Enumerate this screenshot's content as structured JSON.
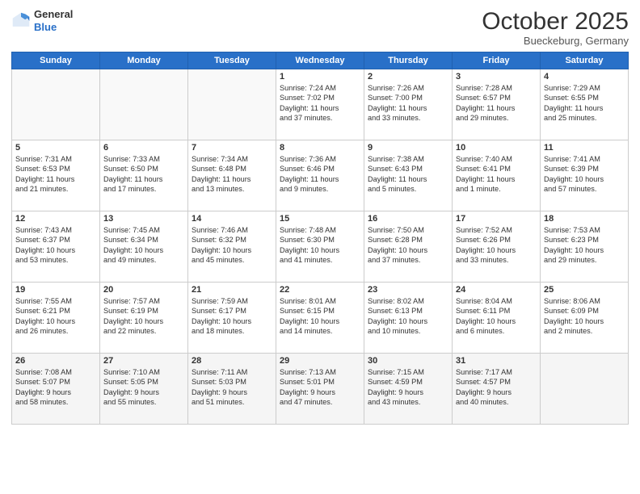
{
  "header": {
    "logo_general": "General",
    "logo_blue": "Blue",
    "month": "October 2025",
    "location": "Bueckeburg, Germany"
  },
  "days_of_week": [
    "Sunday",
    "Monday",
    "Tuesday",
    "Wednesday",
    "Thursday",
    "Friday",
    "Saturday"
  ],
  "weeks": [
    [
      {
        "day": "",
        "content": ""
      },
      {
        "day": "",
        "content": ""
      },
      {
        "day": "",
        "content": ""
      },
      {
        "day": "1",
        "content": "Sunrise: 7:24 AM\nSunset: 7:02 PM\nDaylight: 11 hours\nand 37 minutes."
      },
      {
        "day": "2",
        "content": "Sunrise: 7:26 AM\nSunset: 7:00 PM\nDaylight: 11 hours\nand 33 minutes."
      },
      {
        "day": "3",
        "content": "Sunrise: 7:28 AM\nSunset: 6:57 PM\nDaylight: 11 hours\nand 29 minutes."
      },
      {
        "day": "4",
        "content": "Sunrise: 7:29 AM\nSunset: 6:55 PM\nDaylight: 11 hours\nand 25 minutes."
      }
    ],
    [
      {
        "day": "5",
        "content": "Sunrise: 7:31 AM\nSunset: 6:53 PM\nDaylight: 11 hours\nand 21 minutes."
      },
      {
        "day": "6",
        "content": "Sunrise: 7:33 AM\nSunset: 6:50 PM\nDaylight: 11 hours\nand 17 minutes."
      },
      {
        "day": "7",
        "content": "Sunrise: 7:34 AM\nSunset: 6:48 PM\nDaylight: 11 hours\nand 13 minutes."
      },
      {
        "day": "8",
        "content": "Sunrise: 7:36 AM\nSunset: 6:46 PM\nDaylight: 11 hours\nand 9 minutes."
      },
      {
        "day": "9",
        "content": "Sunrise: 7:38 AM\nSunset: 6:43 PM\nDaylight: 11 hours\nand 5 minutes."
      },
      {
        "day": "10",
        "content": "Sunrise: 7:40 AM\nSunset: 6:41 PM\nDaylight: 11 hours\nand 1 minute."
      },
      {
        "day": "11",
        "content": "Sunrise: 7:41 AM\nSunset: 6:39 PM\nDaylight: 10 hours\nand 57 minutes."
      }
    ],
    [
      {
        "day": "12",
        "content": "Sunrise: 7:43 AM\nSunset: 6:37 PM\nDaylight: 10 hours\nand 53 minutes."
      },
      {
        "day": "13",
        "content": "Sunrise: 7:45 AM\nSunset: 6:34 PM\nDaylight: 10 hours\nand 49 minutes."
      },
      {
        "day": "14",
        "content": "Sunrise: 7:46 AM\nSunset: 6:32 PM\nDaylight: 10 hours\nand 45 minutes."
      },
      {
        "day": "15",
        "content": "Sunrise: 7:48 AM\nSunset: 6:30 PM\nDaylight: 10 hours\nand 41 minutes."
      },
      {
        "day": "16",
        "content": "Sunrise: 7:50 AM\nSunset: 6:28 PM\nDaylight: 10 hours\nand 37 minutes."
      },
      {
        "day": "17",
        "content": "Sunrise: 7:52 AM\nSunset: 6:26 PM\nDaylight: 10 hours\nand 33 minutes."
      },
      {
        "day": "18",
        "content": "Sunrise: 7:53 AM\nSunset: 6:23 PM\nDaylight: 10 hours\nand 29 minutes."
      }
    ],
    [
      {
        "day": "19",
        "content": "Sunrise: 7:55 AM\nSunset: 6:21 PM\nDaylight: 10 hours\nand 26 minutes."
      },
      {
        "day": "20",
        "content": "Sunrise: 7:57 AM\nSunset: 6:19 PM\nDaylight: 10 hours\nand 22 minutes."
      },
      {
        "day": "21",
        "content": "Sunrise: 7:59 AM\nSunset: 6:17 PM\nDaylight: 10 hours\nand 18 minutes."
      },
      {
        "day": "22",
        "content": "Sunrise: 8:01 AM\nSunset: 6:15 PM\nDaylight: 10 hours\nand 14 minutes."
      },
      {
        "day": "23",
        "content": "Sunrise: 8:02 AM\nSunset: 6:13 PM\nDaylight: 10 hours\nand 10 minutes."
      },
      {
        "day": "24",
        "content": "Sunrise: 8:04 AM\nSunset: 6:11 PM\nDaylight: 10 hours\nand 6 minutes."
      },
      {
        "day": "25",
        "content": "Sunrise: 8:06 AM\nSunset: 6:09 PM\nDaylight: 10 hours\nand 2 minutes."
      }
    ],
    [
      {
        "day": "26",
        "content": "Sunrise: 7:08 AM\nSunset: 5:07 PM\nDaylight: 9 hours\nand 58 minutes."
      },
      {
        "day": "27",
        "content": "Sunrise: 7:10 AM\nSunset: 5:05 PM\nDaylight: 9 hours\nand 55 minutes."
      },
      {
        "day": "28",
        "content": "Sunrise: 7:11 AM\nSunset: 5:03 PM\nDaylight: 9 hours\nand 51 minutes."
      },
      {
        "day": "29",
        "content": "Sunrise: 7:13 AM\nSunset: 5:01 PM\nDaylight: 9 hours\nand 47 minutes."
      },
      {
        "day": "30",
        "content": "Sunrise: 7:15 AM\nSunset: 4:59 PM\nDaylight: 9 hours\nand 43 minutes."
      },
      {
        "day": "31",
        "content": "Sunrise: 7:17 AM\nSunset: 4:57 PM\nDaylight: 9 hours\nand 40 minutes."
      },
      {
        "day": "",
        "content": ""
      }
    ]
  ]
}
